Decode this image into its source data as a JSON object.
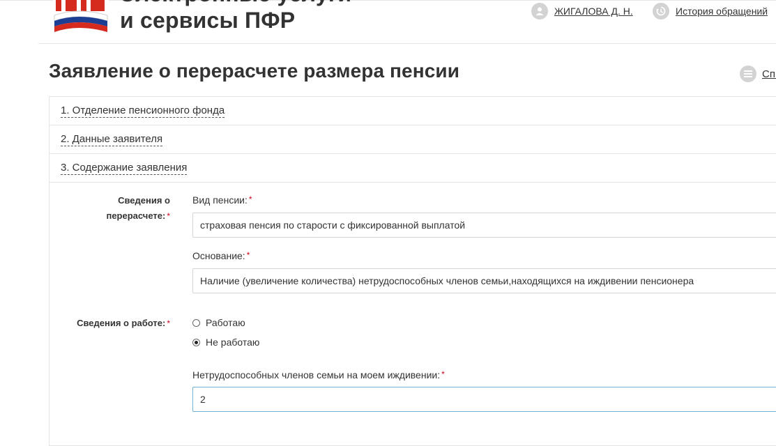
{
  "header": {
    "brand_line1": "Электронные услуги",
    "brand_line2": "и сервисы ПФР",
    "user_name": "ЖИГАЛОВА Д. Н.",
    "history_label": "История обращений"
  },
  "page": {
    "title": "Заявление о перерасчете размера пенсии",
    "side_menu_label": "Спи"
  },
  "steps": [
    {
      "label": "1. Отделение пенсионного фонда"
    },
    {
      "label": "2. Данные заявителя"
    },
    {
      "label": "3. Содержание заявления"
    }
  ],
  "form": {
    "recalc_section_line1": "Сведения о",
    "recalc_section_line2": "перерасчете:",
    "required_mark": "*",
    "pension_type_label": "Вид пенсии:",
    "pension_type_value": "страховая пенсия по старости с фиксированной выплатой",
    "basis_label": "Основание:",
    "basis_value": "Наличие (увеличение количества) нетрудоспособных членов семьи,находящихся на иждивении пенсионера",
    "work_section_label": "Сведения о работе:",
    "work_options": [
      {
        "label": "Работаю",
        "checked": false
      },
      {
        "label": "Не работаю",
        "checked": true
      }
    ],
    "dependents_label": "Нетрудоспособных членов семьи на моем иждивении:",
    "dependents_value": "2"
  },
  "colors": {
    "required": "#d0021b",
    "focus_border": "#6fb3d9",
    "icon_circle": "#d3d3d3",
    "flag_red": "#d52b1e",
    "flag_blue": "#1c3f94"
  }
}
